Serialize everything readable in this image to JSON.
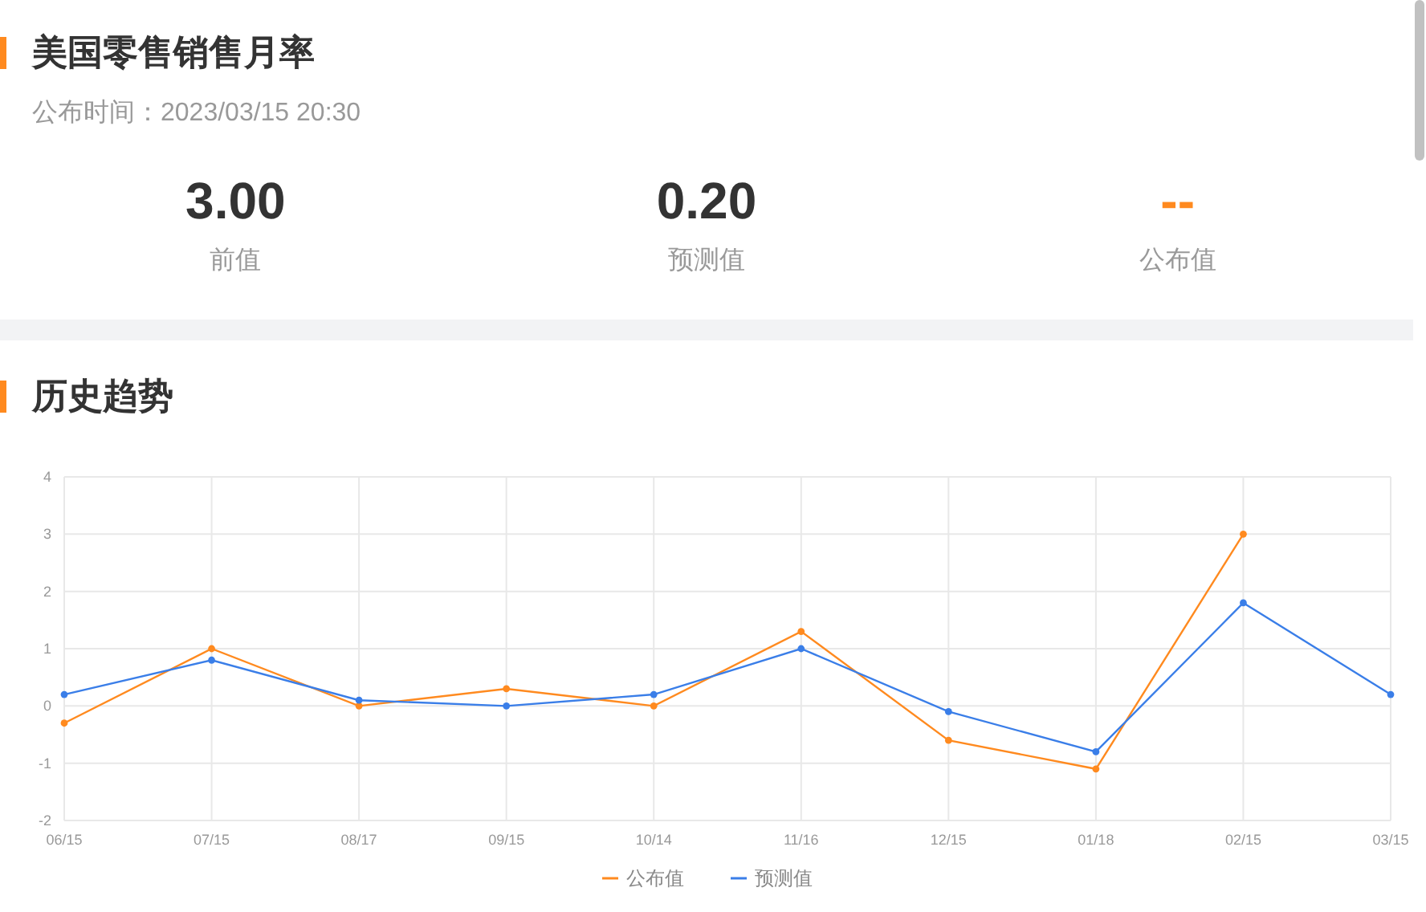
{
  "header": {
    "title": "美国零售销售月率",
    "publish_time": "公布时间：2023/03/15 20:30"
  },
  "stats": [
    {
      "value": "3.00",
      "label": "前值",
      "color": "#333333"
    },
    {
      "value": "0.20",
      "label": "预测值",
      "color": "#333333"
    },
    {
      "value": "--",
      "label": "公布值",
      "color": "#ff8a1f"
    }
  ],
  "history": {
    "title": "历史趋势",
    "chart_data": {
      "type": "line",
      "grid": true,
      "legend": true,
      "categories": [
        "06/15",
        "07/15",
        "08/17",
        "09/15",
        "10/14",
        "11/16",
        "12/15",
        "01/18",
        "02/15",
        "03/15"
      ],
      "ylim": [
        -2,
        4
      ],
      "yticks": [
        -2,
        -1,
        0,
        1,
        2,
        3,
        4
      ],
      "series": [
        {
          "name": "公布值",
          "color": "#ff8a1f",
          "marker": "circle",
          "values": [
            -0.3,
            1.0,
            0.0,
            0.3,
            0.0,
            1.3,
            -0.6,
            -1.1,
            3.0,
            null
          ]
        },
        {
          "name": "预测值",
          "color": "#3a7ee8",
          "marker": "circle",
          "values": [
            0.2,
            0.8,
            0.1,
            0.0,
            0.2,
            1.0,
            -0.1,
            -0.8,
            1.8,
            0.2
          ]
        }
      ]
    }
  }
}
